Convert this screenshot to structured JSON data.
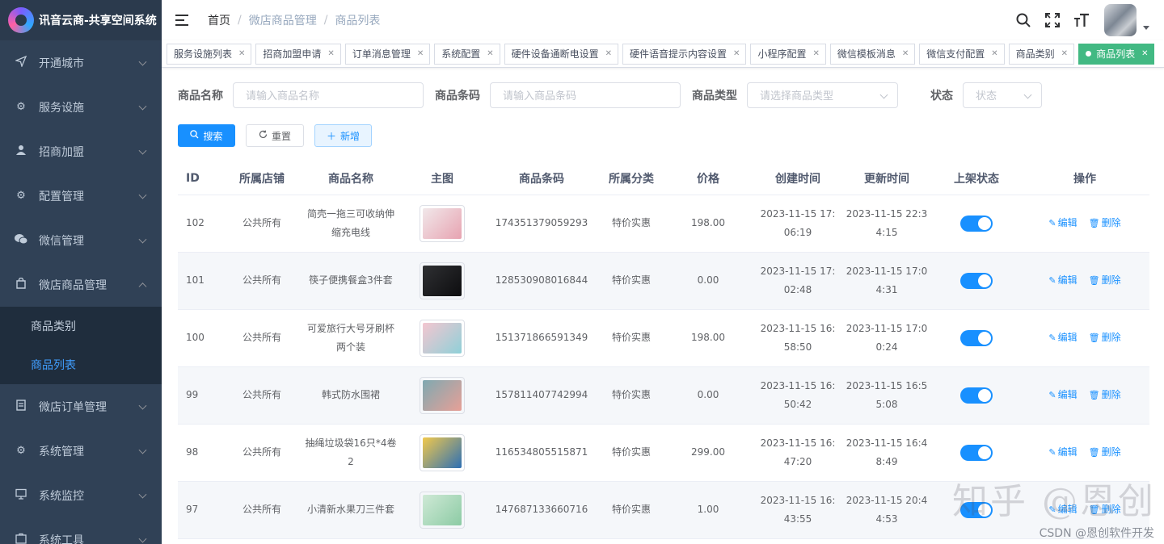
{
  "app": {
    "title": "讯音云商-共享空间系统"
  },
  "sidebar": {
    "items": [
      {
        "label": "开通城市",
        "icon": "send-icon"
      },
      {
        "label": "服务设施",
        "icon": "gear-icon"
      },
      {
        "label": "招商加盟",
        "icon": "user-icon"
      },
      {
        "label": "配置管理",
        "icon": "gear-icon"
      },
      {
        "label": "微信管理",
        "icon": "wechat-icon"
      },
      {
        "label": "微店商品管理",
        "icon": "shop-icon"
      },
      {
        "label": "微店订单管理",
        "icon": "document-icon"
      },
      {
        "label": "系统管理",
        "icon": "gear-icon"
      },
      {
        "label": "系统监控",
        "icon": "monitor-icon"
      },
      {
        "label": "系统工具",
        "icon": "tool-icon"
      }
    ],
    "submenu": [
      {
        "label": "商品类别"
      },
      {
        "label": "商品列表"
      }
    ]
  },
  "breadcrumb": {
    "home": "首页",
    "section": "微店商品管理",
    "page": "商品列表"
  },
  "tabs": [
    {
      "label": "服务设施列表"
    },
    {
      "label": "招商加盟申请"
    },
    {
      "label": "订单消息管理"
    },
    {
      "label": "系统配置"
    },
    {
      "label": "硬件设备通断电设置"
    },
    {
      "label": "硬件语音提示内容设置"
    },
    {
      "label": "小程序配置"
    },
    {
      "label": "微信模板消息"
    },
    {
      "label": "微信支付配置"
    },
    {
      "label": "商品类别"
    },
    {
      "label": "商品列表"
    }
  ],
  "filters": {
    "name_label": "商品名称",
    "name_placeholder": "请输入商品名称",
    "barcode_label": "商品条码",
    "barcode_placeholder": "请输入商品条码",
    "type_label": "商品类型",
    "type_placeholder": "请选择商品类型",
    "status_label": "状态",
    "status_placeholder": "状态"
  },
  "buttons": {
    "search": "搜索",
    "reset": "重置",
    "add": "新增"
  },
  "table": {
    "headers": [
      "ID",
      "所属店铺",
      "商品名称",
      "主图",
      "商品条码",
      "所属分类",
      "价格",
      "创建时间",
      "更新时间",
      "上架状态",
      "操作"
    ],
    "edit_label": "编辑",
    "delete_label": "删除",
    "rows": [
      {
        "id": "102",
        "shop": "公共所有",
        "name": "简壳一拖三可收纳伸缩充电线",
        "barcode": "174351379059293",
        "category": "特价实惠",
        "price": "198.00",
        "created": "2023-11-15 17:06:19",
        "updated": "2023-11-15 22:34:15",
        "listed": true,
        "img_colors": [
          "#f1e8ea",
          "#e7a3b1"
        ]
      },
      {
        "id": "101",
        "shop": "公共所有",
        "name": "筷子便携餐盒3件套",
        "barcode": "128530908016844",
        "category": "特价实惠",
        "price": "0.00",
        "created": "2023-11-15 17:02:48",
        "updated": "2023-11-15 17:04:31",
        "listed": true,
        "img_colors": [
          "#2f3033",
          "#0d0d0f"
        ]
      },
      {
        "id": "100",
        "shop": "公共所有",
        "name": "可爱旅行大号牙刷杯两个装",
        "barcode": "151371866591349",
        "category": "特价实惠",
        "price": "198.00",
        "created": "2023-11-15 16:58:50",
        "updated": "2023-11-15 17:00:24",
        "listed": true,
        "img_colors": [
          "#f4c6d0",
          "#8fd0d8"
        ]
      },
      {
        "id": "99",
        "shop": "公共所有",
        "name": "韩式防水围裙",
        "barcode": "157811407742994",
        "category": "特价实惠",
        "price": "0.00",
        "created": "2023-11-15 16:50:42",
        "updated": "2023-11-15 16:55:08",
        "listed": true,
        "img_colors": [
          "#7fa9b1",
          "#e7a097"
        ]
      },
      {
        "id": "98",
        "shop": "公共所有",
        "name": "抽绳垃圾袋16只*4卷2",
        "barcode": "116534805515871",
        "category": "特价实惠",
        "price": "299.00",
        "created": "2023-11-15 16:47:20",
        "updated": "2023-11-15 16:48:49",
        "listed": true,
        "img_colors": [
          "#f2c94c",
          "#2d6fb4"
        ]
      },
      {
        "id": "97",
        "shop": "公共所有",
        "name": "小清新水果刀三件套",
        "barcode": "147687133660716",
        "category": "特价实惠",
        "price": "1.00",
        "created": "2023-11-15 16:43:55",
        "updated": "2023-11-15 20:44:53",
        "listed": true,
        "img_colors": [
          "#cfe9d6",
          "#8ccba4"
        ]
      }
    ]
  },
  "watermark": "知乎 @恩创",
  "csdn_mark": "CSDN @恩创软件开发",
  "colors": {
    "sidebar_bg": "#304156",
    "primary": "#1890ff",
    "active_tag": "#42b983",
    "menu_text": "#bfcbd9"
  }
}
